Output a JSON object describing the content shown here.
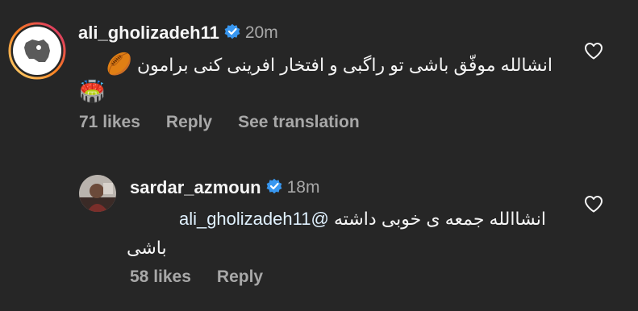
{
  "comments": [
    {
      "username": "ali_gholizadeh11",
      "time": "20m",
      "text": "انشالله موفّق باشی تو راگبی و افتخار افرینی کنی برامون",
      "emoji_1": "🏉",
      "emoji_2": "🏟️",
      "likes": "71 likes",
      "reply": "Reply",
      "see_translation": "See translation",
      "avatar_icon": "iran-map-icon"
    },
    {
      "username": "sardar_azmoun",
      "time": "18m",
      "mention": "@ali_gholizadeh11",
      "text_line1": "انشاالله جمعه ی خوبی داشته",
      "text_line2": "باشی",
      "likes": "58 likes",
      "reply": "Reply",
      "avatar_icon": "profile-photo"
    }
  ],
  "colors": {
    "background": "#262626",
    "text": "#f5f5f5",
    "muted": "#a8a8a8",
    "verified": "#3897f0",
    "story_ring_start": "#feda75",
    "story_ring_end": "#d62976"
  }
}
